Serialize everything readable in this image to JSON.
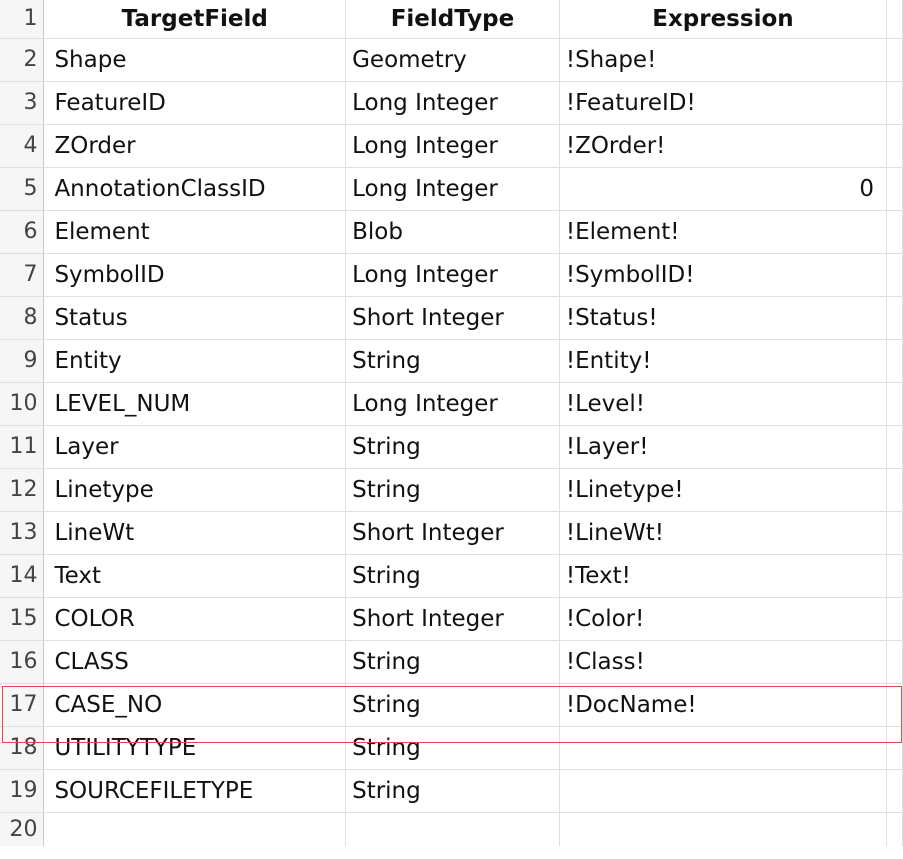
{
  "headers": [
    "TargetField",
    "FieldType",
    "Expression"
  ],
  "rows": [
    {
      "num": "1"
    },
    {
      "num": "2",
      "field": "Shape",
      "type": "Geometry",
      "expr": "!Shape!"
    },
    {
      "num": "3",
      "field": "FeatureID",
      "type": "Long Integer",
      "expr": "!FeatureID!"
    },
    {
      "num": "4",
      "field": "ZOrder",
      "type": "Long Integer",
      "expr": "!ZOrder!"
    },
    {
      "num": "5",
      "field": "AnnotationClassID",
      "type": "Long Integer",
      "expr": "0"
    },
    {
      "num": "6",
      "field": "Element",
      "type": "Blob",
      "expr": "!Element!"
    },
    {
      "num": "7",
      "field": "SymbolID",
      "type": "Long Integer",
      "expr": "!SymbolID!"
    },
    {
      "num": "8",
      "field": "Status",
      "type": "Short Integer",
      "expr": "!Status!"
    },
    {
      "num": "9",
      "field": "Entity",
      "type": "String",
      "expr": "!Entity!"
    },
    {
      "num": "10",
      "field": "LEVEL_NUM",
      "type": "Long Integer",
      "expr": "!Level!"
    },
    {
      "num": "11",
      "field": "Layer",
      "type": "String",
      "expr": "!Layer!"
    },
    {
      "num": "12",
      "field": "Linetype",
      "type": "String",
      "expr": "!Linetype!"
    },
    {
      "num": "13",
      "field": "LineWt",
      "type": "Short Integer",
      "expr": "!LineWt!"
    },
    {
      "num": "14",
      "field": "Text",
      "type": "String",
      "expr": "!Text!"
    },
    {
      "num": "15",
      "field": "COLOR",
      "type": "Short Integer",
      "expr": "!Color!"
    },
    {
      "num": "16",
      "field": "CLASS",
      "type": "String",
      "expr": "!Class!"
    },
    {
      "num": "17",
      "field": "CASE_NO",
      "type": "String",
      "expr": "!DocName!"
    },
    {
      "num": "18",
      "field": "UTILITYTYPE",
      "type": "String",
      "expr": ""
    },
    {
      "num": "19",
      "field": "SOURCEFILETYPE",
      "type": "String",
      "expr": ""
    },
    {
      "num": "20",
      "field": "",
      "type": "",
      "expr": ""
    }
  ],
  "highlight_color": "#e5484d"
}
